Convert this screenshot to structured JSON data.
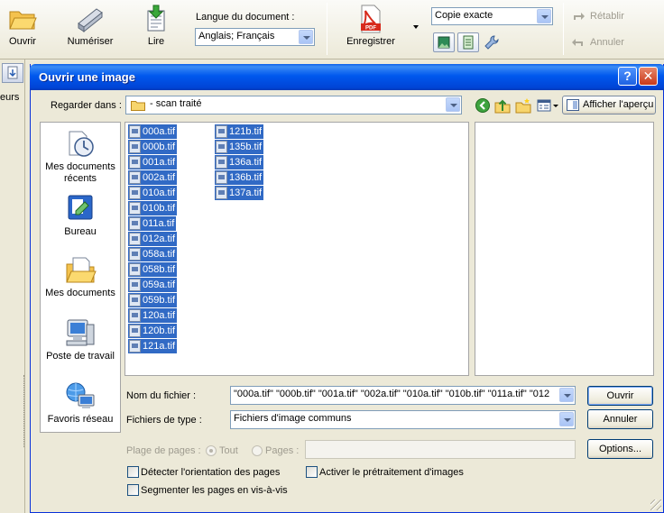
{
  "toolbar": {
    "open_label": "Ouvrir",
    "scan_label": "Numériser",
    "read_label": "Lire",
    "language_label": "Langue du document :",
    "language_value": "Anglais; Français",
    "save_label": "Enregistrer",
    "output_mode_value": "Copie exacte",
    "restore_label": "Rétablir",
    "cancel_label": "Annuler"
  },
  "left_strip": {
    "label": "eurs"
  },
  "dialog": {
    "title": "Ouvrir une image",
    "help_glyph": "?",
    "close_glyph": "✕",
    "look_in_label": "Regarder dans :",
    "look_in_value": "- scan traité",
    "preview_toggle_label": "Afficher l'aperçu",
    "places": [
      {
        "label": "Mes documents récents"
      },
      {
        "label": "Bureau"
      },
      {
        "label": "Mes documents"
      },
      {
        "label": "Poste de travail"
      },
      {
        "label": "Favoris réseau"
      }
    ],
    "files_col1": [
      "000a.tif",
      "000b.tif",
      "001a.tif",
      "002a.tif",
      "010a.tif",
      "010b.tif",
      "011a.tif",
      "012a.tif",
      "058a.tif",
      "058b.tif",
      "059a.tif",
      "059b.tif",
      "120a.tif",
      "120b.tif",
      "121a.tif"
    ],
    "files_col2": [
      "121b.tif",
      "135b.tif",
      "136a.tif",
      "136b.tif",
      "137a.tif"
    ],
    "filename_label": "Nom du fichier :",
    "filename_value": "\"000a.tif\" \"000b.tif\" \"001a.tif\" \"002a.tif\" \"010a.tif\" \"010b.tif\" \"011a.tif\" \"012",
    "filetype_label": "Fichiers de type :",
    "filetype_value": "Fichiers d'image communs",
    "open_button": "Ouvrir",
    "cancel_button": "Annuler",
    "page_range_label": "Plage de pages :",
    "all_label": "Tout",
    "pages_label": "Pages :",
    "options_button": "Options...",
    "detect_orientation_label": "Détecter l'orientation des pages",
    "preprocess_label": "Activer le prétraitement d'images",
    "split_pages_label": "Segmenter les pages en vis-à-vis"
  }
}
